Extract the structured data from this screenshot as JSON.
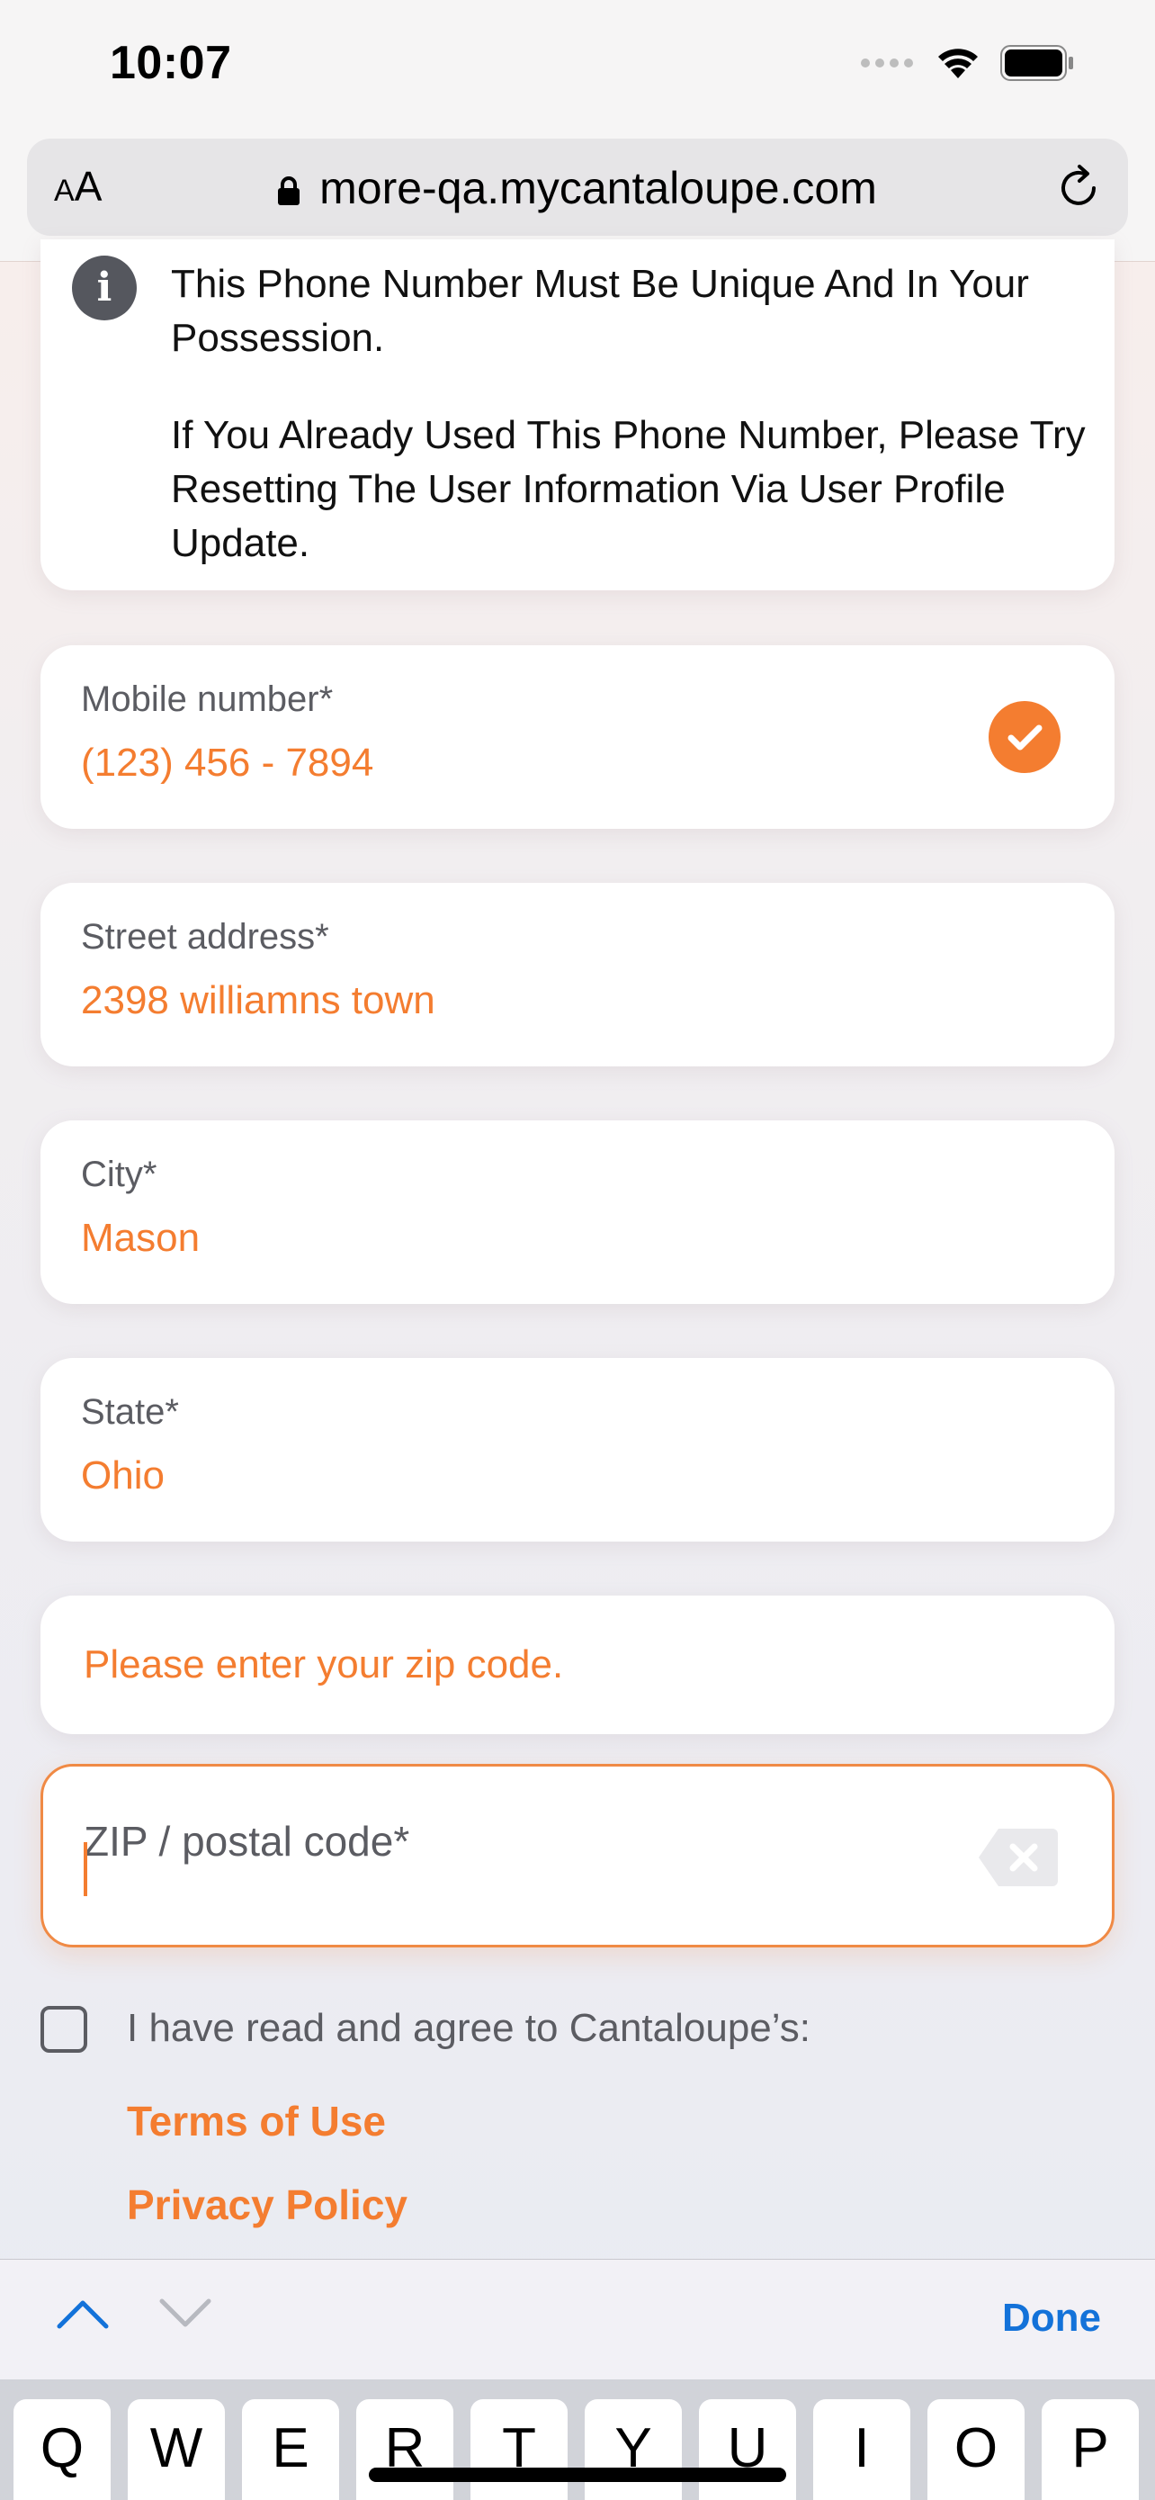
{
  "status_bar": {
    "time": "10:07"
  },
  "url_bar": {
    "aa_small": "A",
    "aa_large": "A",
    "url": "more-qa.mycantaloupe.com",
    "icons": [
      "lock-icon",
      "reload-icon"
    ]
  },
  "info_box": {
    "line1": "This Phone Number Must Be Unique And In Your Possession.",
    "line2": "If You Already Used This Phone Number, Please Try Resetting The User Information Via User Profile Update.",
    "icon": "info-icon"
  },
  "form": {
    "mobile": {
      "label": "Mobile number*",
      "value": "(123) 456 - 7894",
      "verified": true
    },
    "street": {
      "label": "Street address*",
      "value": "2398 williamns town"
    },
    "city": {
      "label": "City*",
      "value": "Mason"
    },
    "state": {
      "label": "State*",
      "value": "Ohio"
    },
    "zip_error": "Please enter your zip code.",
    "zip": {
      "placeholder": "ZIP / postal code*",
      "value": ""
    },
    "agree": {
      "text": "I have read and agree to Cantaloupe’s:",
      "checked": false,
      "terms_label": "Terms of Use",
      "privacy_label": "Privacy Policy"
    }
  },
  "keyboard_toolbar": {
    "done_label": "Done"
  },
  "keyboard": {
    "keys": [
      "Q",
      "W",
      "E",
      "R",
      "T",
      "Y",
      "U",
      "I",
      "O",
      "P"
    ]
  },
  "colors": {
    "accent": "#f47d30",
    "link_blue": "#1372d9",
    "label_gray": "#5b5c62"
  }
}
